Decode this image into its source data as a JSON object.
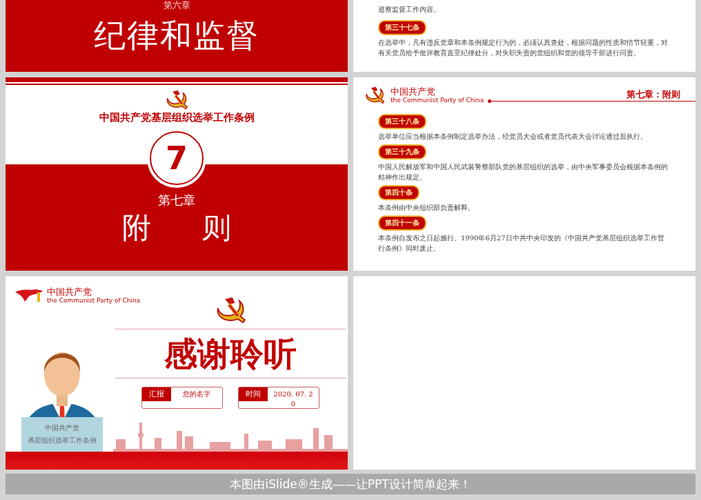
{
  "slides": [
    {
      "kind": "chapter-end",
      "chapter": "第六章",
      "title": "纪律和监督"
    },
    {
      "kind": "articles",
      "paragraph": "巡察监督工作内容。",
      "articles": [
        {
          "label": "第三十七条",
          "text": "在选举中，凡有违反党章和本条例规定行为的，必须认真查处，根据问题的性质和情节轻重，对有关党员给予批评教育直至纪律处分，对失职失责的党组织和党的领导干部进行问责。"
        }
      ]
    },
    {
      "kind": "chapter",
      "subtitle": "中国共产党基层组织选举工作条例",
      "number": "7",
      "chapter": "第七章",
      "title": "附 则"
    },
    {
      "kind": "articles-header",
      "logo_cn": "中国共产党",
      "logo_en": "the Communist Party of China",
      "heading": "第七章：附则",
      "articles": [
        {
          "label": "第三十八条",
          "text": "选举单位应当根据本条例制定选举办法，经党员大会或者党员代表大会讨论通过后执行。"
        },
        {
          "label": "第三十九条",
          "text": "中国人民解放军和中国人民武装警察部队党的基层组织的选举，由中央军事委员会根据本条例的精神作出规定。"
        },
        {
          "label": "第四十条",
          "text": "本条例由中央组织部负责解释。"
        },
        {
          "label": "第四十一条",
          "text": "本条例自发布之日起施行。1990年6月27日中共中央印发的《中国共产党基层组织选举工作暂行条例》同时废止。"
        }
      ]
    },
    {
      "kind": "thanks",
      "logo_cn": "中国共产党",
      "logo_en": "the Communist Party of China",
      "title": "感谢聆听",
      "sign_lines": [
        "中国共产党",
        "基层组织选举工作条例"
      ],
      "fields": [
        {
          "label": "汇报",
          "value": "您的名字"
        },
        {
          "label": "时间",
          "value": "2020. 07. 20"
        }
      ]
    },
    {
      "kind": "blank"
    }
  ],
  "footer": "本图由iSlide®生成——让PPT设计简单起来！"
}
